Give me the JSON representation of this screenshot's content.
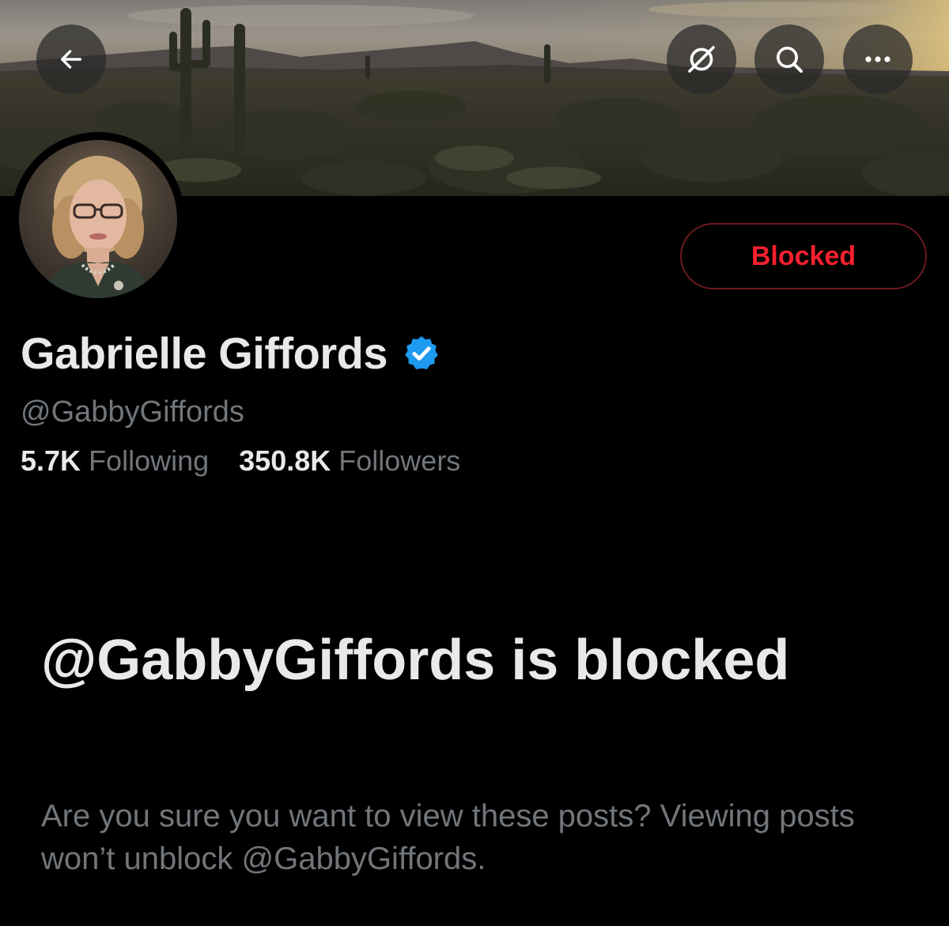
{
  "header": {
    "back_icon": "arrow-left-icon",
    "grok_icon": "grok-icon",
    "search_icon": "search-icon",
    "more_icon": "more-horizontal-icon"
  },
  "profile": {
    "display_name": "Gabrielle Giffords",
    "handle": "@GabbyGiffords",
    "verified": true,
    "verified_color": "#1d9bf0",
    "following_count": "5.7K",
    "following_label": "Following",
    "followers_count": "350.8K",
    "followers_label": "Followers"
  },
  "actions": {
    "blocked_label": "Blocked",
    "blocked_color": "#f4212e"
  },
  "notice": {
    "title": "@GabbyGiffords is blocked",
    "body": "Are you sure you want to view these posts? Viewing posts won’t unblock @GabbyGiffords."
  }
}
